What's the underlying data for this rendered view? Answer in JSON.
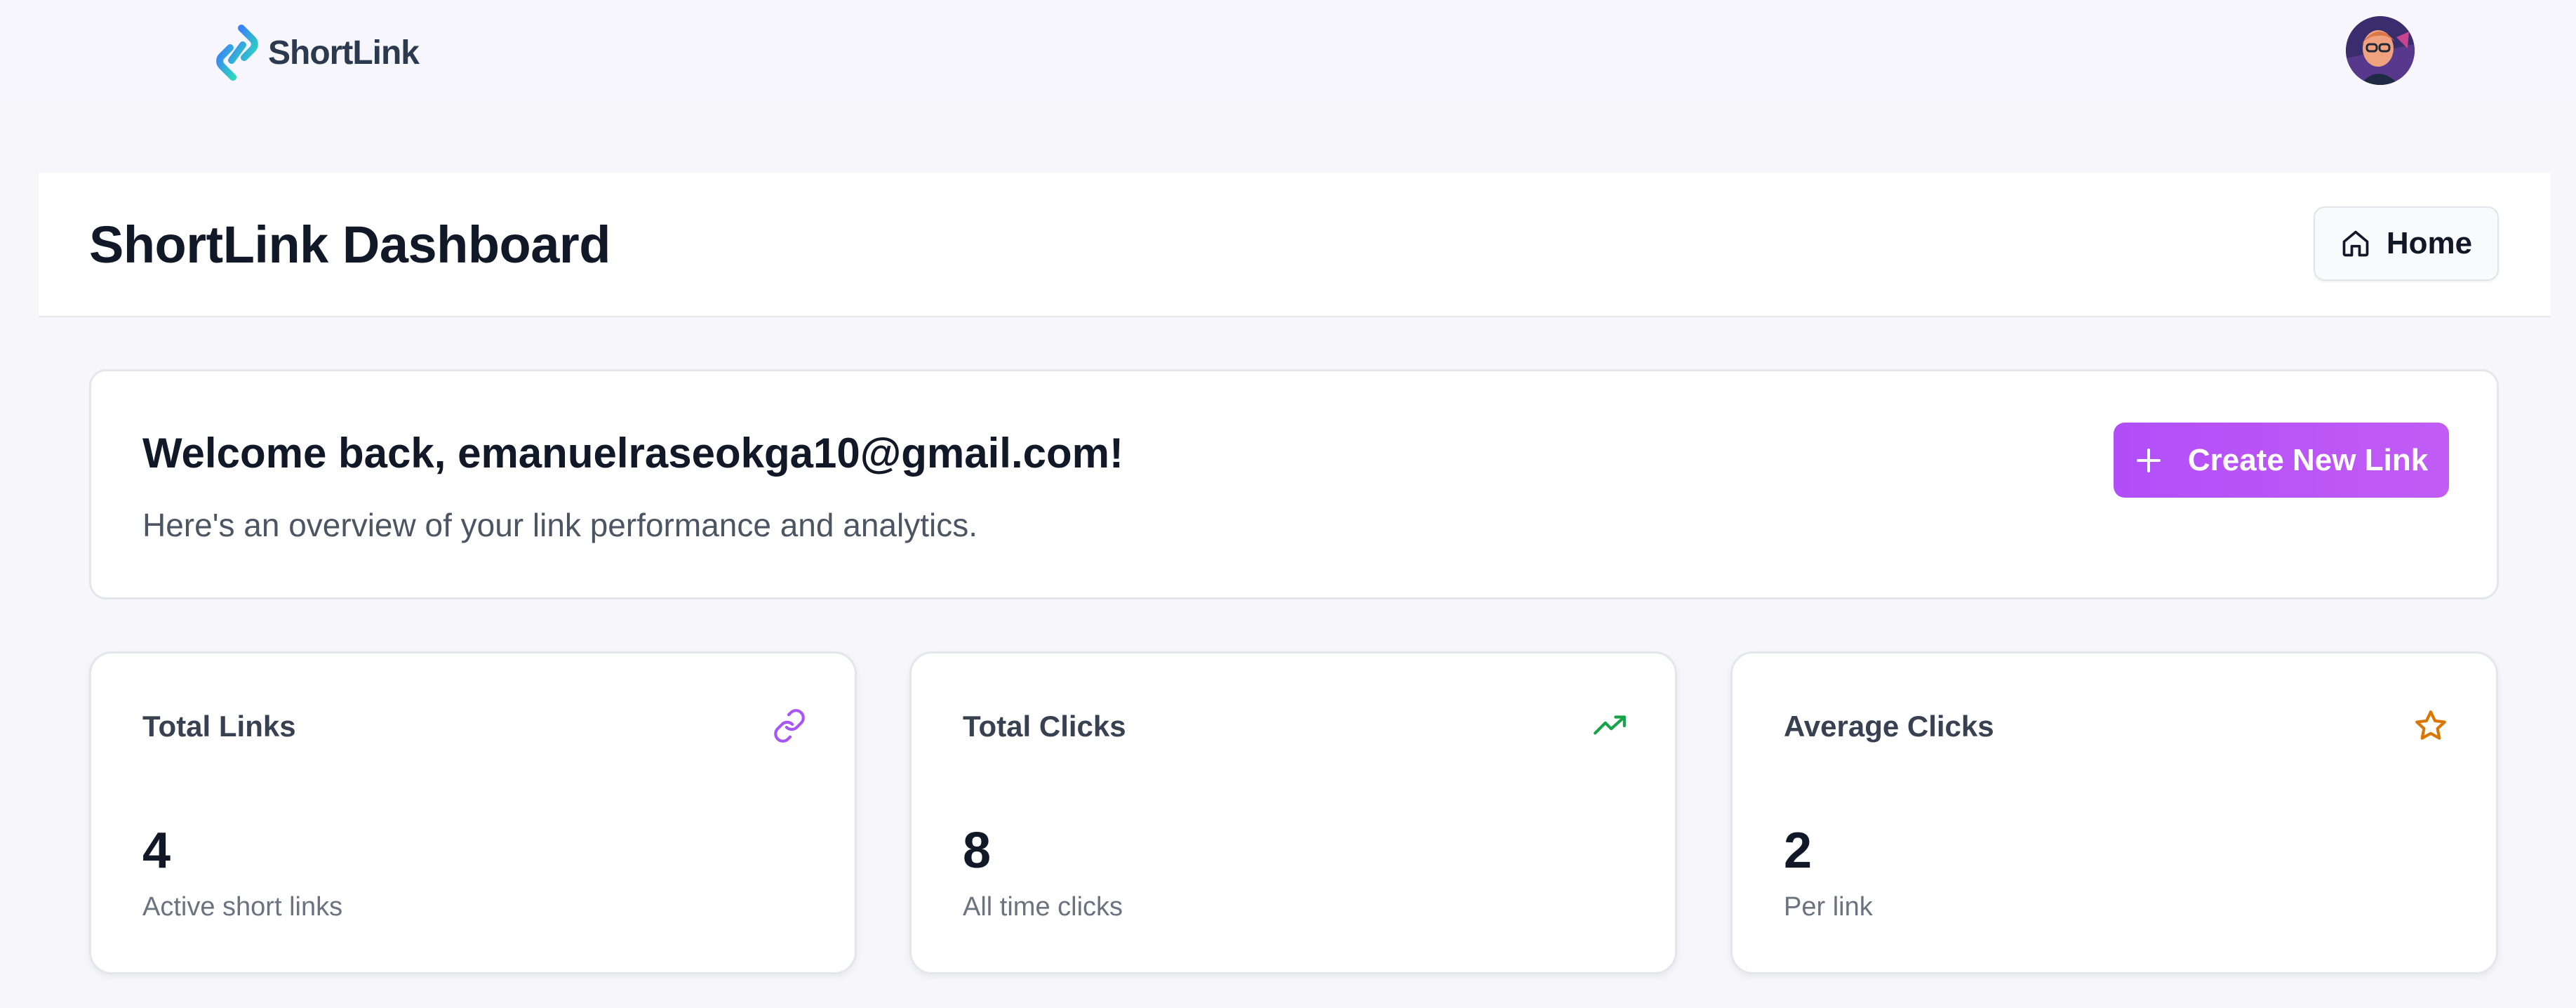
{
  "brand": {
    "name": "ShortLink",
    "colors": {
      "logo_start": "#3b82f6",
      "logo_end": "#2dd4bf",
      "text": "#2c3a4f"
    }
  },
  "user": {
    "avatar_icon": "avatar-icon"
  },
  "header": {
    "title": "ShortLink Dashboard",
    "home_label": "Home",
    "home_icon": "home-icon"
  },
  "welcome": {
    "title": "Welcome back, emanuelraseokga10@gmail.com!",
    "subtitle": "Here's an overview of your link performance and analytics.",
    "create_label": "Create New Link",
    "create_icon": "plus-icon",
    "accent": "#b14ef8"
  },
  "stats": [
    {
      "label": "Total Links",
      "value": "4",
      "caption": "Active short links",
      "icon": "link-icon",
      "icon_color": "#a855f7"
    },
    {
      "label": "Total Clicks",
      "value": "8",
      "caption": "All time clicks",
      "icon": "trending-up-icon",
      "icon_color": "#16a34a"
    },
    {
      "label": "Average Clicks",
      "value": "2",
      "caption": "Per link",
      "icon": "star-icon",
      "icon_color": "#d97706"
    }
  ]
}
